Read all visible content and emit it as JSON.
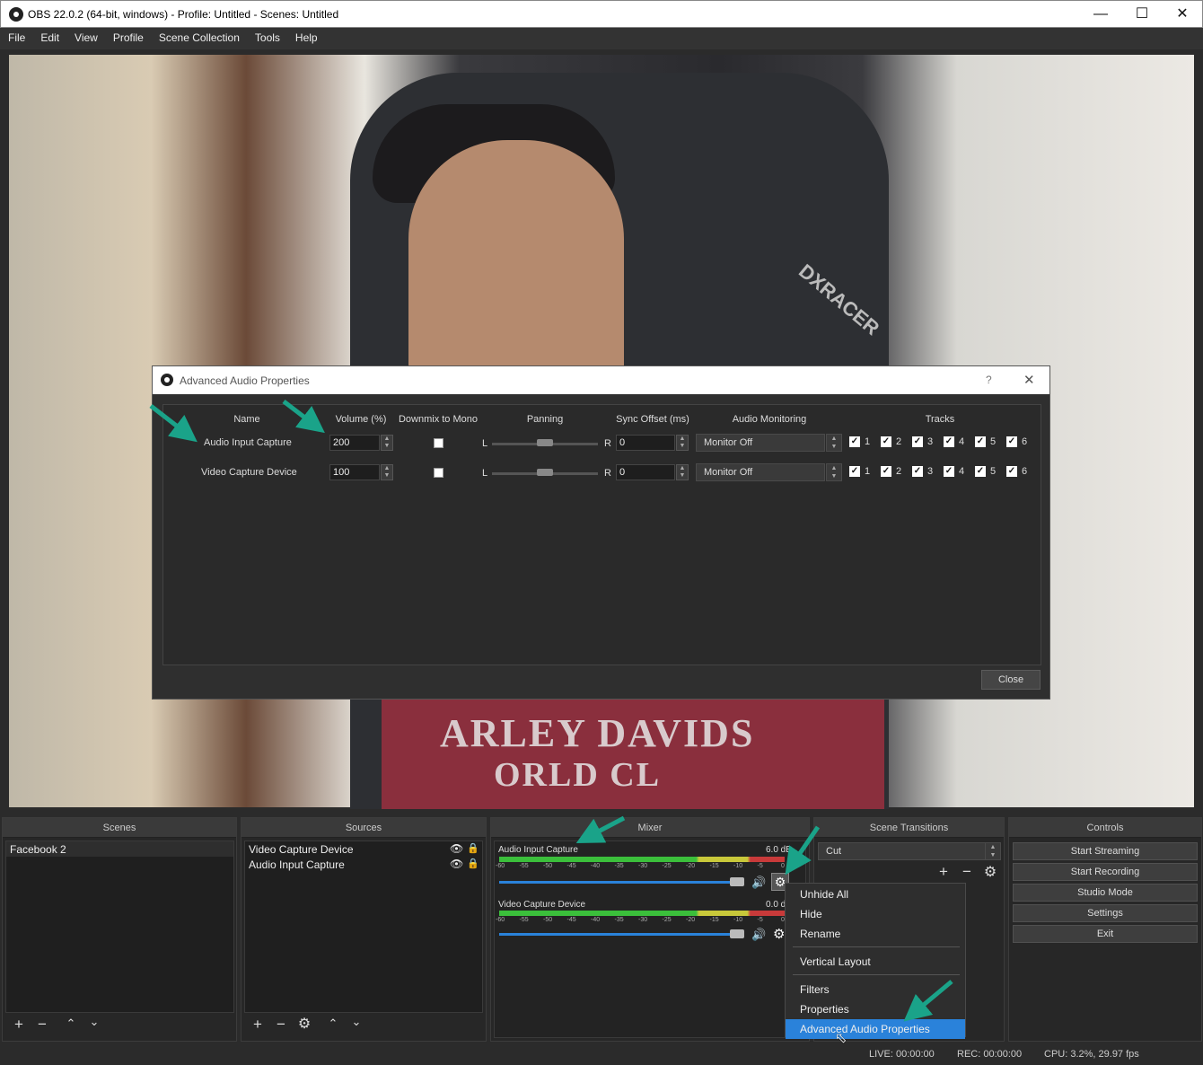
{
  "window": {
    "title": "OBS 22.0.2 (64-bit, windows) - Profile: Untitled - Scenes: Untitled"
  },
  "menu": [
    "File",
    "Edit",
    "View",
    "Profile",
    "Scene Collection",
    "Tools",
    "Help"
  ],
  "preview": {
    "shirt_text": "ARLEY DAVIDS",
    "shirt_text2": "ORLD CL",
    "chair_logo": "DXRACER"
  },
  "dialog": {
    "title": "Advanced Audio Properties",
    "help": "?",
    "columns": {
      "name": "Name",
      "volume": "Volume (%)",
      "downmix": "Downmix to Mono",
      "panning": "Panning",
      "sync": "Sync Offset (ms)",
      "monitoring": "Audio Monitoring",
      "tracks": "Tracks"
    },
    "rows": [
      {
        "name": "Audio Input Capture",
        "volume": "200",
        "pan_l": "L",
        "pan_r": "R",
        "sync": "0",
        "monitoring": "Monitor Off"
      },
      {
        "name": "Video Capture Device",
        "volume": "100",
        "pan_l": "L",
        "pan_r": "R",
        "sync": "0",
        "monitoring": "Monitor Off"
      }
    ],
    "track_labels": [
      "1",
      "2",
      "3",
      "4",
      "5",
      "6"
    ],
    "close": "Close"
  },
  "docks": {
    "scenes": {
      "title": "Scenes",
      "items": [
        "Facebook 2"
      ]
    },
    "sources": {
      "title": "Sources",
      "items": [
        "Video Capture Device",
        "Audio Input Capture"
      ]
    },
    "mixer": {
      "title": "Mixer",
      "channels": [
        {
          "name": "Audio Input Capture",
          "db": "6.0 dB",
          "volume_fraction": 0.97
        },
        {
          "name": "Video Capture Device",
          "db": "0.0 d",
          "volume_fraction": 0.97
        }
      ],
      "scale": [
        "-60",
        "-55",
        "-50",
        "-45",
        "-40",
        "-35",
        "-30",
        "-25",
        "-20",
        "-15",
        "-10",
        "-5",
        "0"
      ]
    },
    "transitions": {
      "title": "Scene Transitions",
      "selected": "Cut"
    },
    "controls": {
      "title": "Controls",
      "buttons": [
        "Start Streaming",
        "Start Recording",
        "Studio Mode",
        "Settings",
        "Exit"
      ]
    }
  },
  "context_menu": {
    "items": [
      "Unhide All",
      "Hide",
      "Rename",
      "Vertical Layout",
      "Filters",
      "Properties",
      "Advanced Audio Properties"
    ],
    "highlighted": "Advanced Audio Properties"
  },
  "status": {
    "live": "LIVE: 00:00:00",
    "rec": "REC: 00:00:00",
    "cpu": "CPU: 3.2%, 29.97 fps"
  },
  "colors": {
    "accent": "#2a82da",
    "arrow": "#1aa389",
    "meter_green": "#3bbf3b",
    "meter_yellow": "#c8c83a",
    "meter_red": "#c83a3a"
  }
}
